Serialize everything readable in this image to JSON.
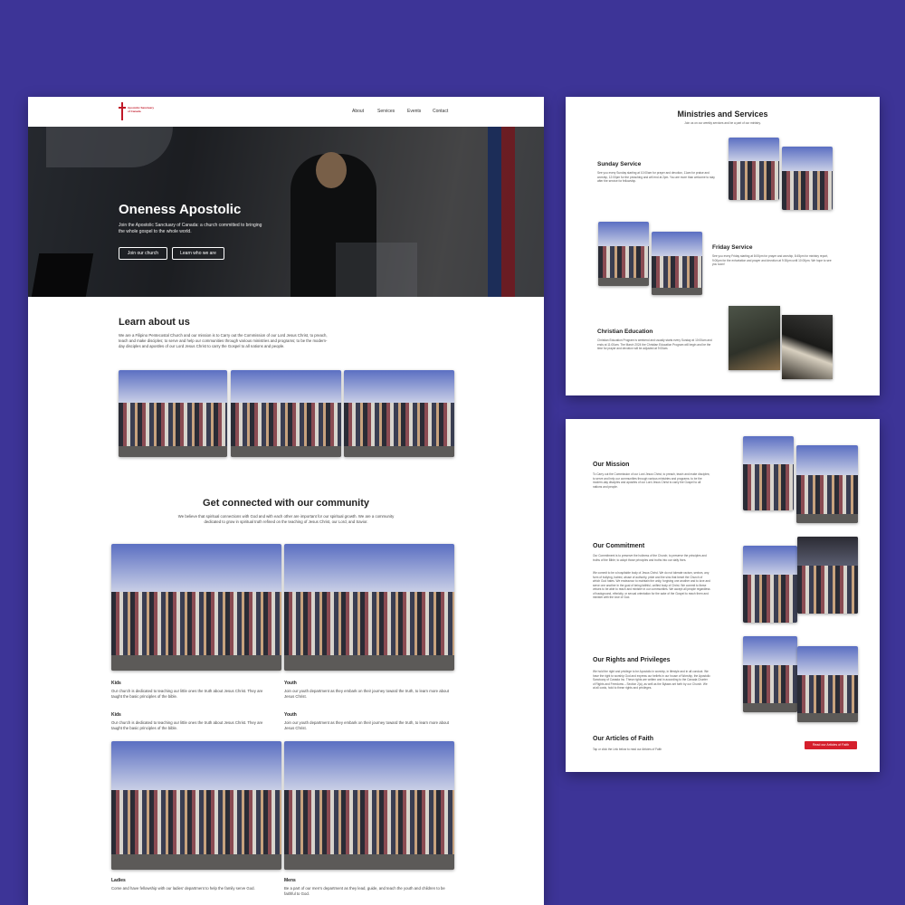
{
  "colors": {
    "background": "#3d3497",
    "accent": "#d51f2c"
  },
  "header": {
    "logo_text": "Apostolic Sanctuary of Canada",
    "nav": [
      "About",
      "Services",
      "Events",
      "Contact"
    ]
  },
  "hero": {
    "title": "Oneness Apostolic",
    "subtitle": "Join the Apostolic Sanctuary of Canada: a church committed to bringing the whole gospel to the whole world.",
    "btn_join": "Join our church",
    "btn_learn": "Learn who we are"
  },
  "learn": {
    "title": "Learn about us",
    "text": "We are a Filipino Pentecostal Church and our mission is to Carry out the Commission of our Lord Jesus Christ, to preach, teach and make disciples; to serve and help our communities through various ministries and programs; to be the modern-day disciples and apostles of our Lord Jesus Christ to carry the Gospel to all nations and people."
  },
  "community": {
    "title": "Get connected with our community",
    "text": "We believe that spiritual connections with God and with each other are important for our spiritual growth. We are a community dedicated to grow in spiritual truth refined on the teaching of Jesus Christ, our Lord, and Savior.",
    "groups": [
      {
        "name": "Kids",
        "desc": "Our church is dedicated to teaching our little ones the truth about Jesus Christ. They are taught the basic principles of the bible."
      },
      {
        "name": "Youth",
        "desc": "Join our youth department as they embark on their journey toward the truth, to learn more about Jesus Christ."
      },
      {
        "name": "Kids",
        "desc": "Our church is dedicated to teaching our little ones the truth about Jesus Christ. They are taught the basic principles of the bible."
      },
      {
        "name": "Youth",
        "desc": "Join our youth department as they embark on their journey toward the truth, to learn more about Jesus Christ."
      },
      {
        "name": "Ladies",
        "desc": "Come and have fellowship with our ladies' department to help the family serve God."
      },
      {
        "name": "Mens",
        "desc": "Be a part of our men's department as they lead, guide, and teach the youth and children to be faithful to God."
      }
    ]
  },
  "ministries": {
    "title": "Ministries and Services",
    "subtitle": "Join us on our weekly services and be a part of our ministry.",
    "items": [
      {
        "name": "Sunday Service",
        "desc": "See you every Sunday starting at 10:00am for prayer and devotion, 11am for praise and worship, 12:00pm for the preaching and will end at 2pm. You are more than welcome to stay after the service for fellowship."
      },
      {
        "name": "Friday Service",
        "desc": "See you every Friday starting at 8:00pm for prayer and worship, 8:45pm for ministry report, 9:00pm for the exhortation and prayer and devotion at 9:30pm until 10:00pm. We hope to see you soon!"
      },
      {
        "name": "Christian Education",
        "desc": "Christian Education Program is weekend and usually starts every Sunday at 10:00am and ends at 11:00am. The March 2024 the Christian Education Program will begin and be the time for prayer and devotion will be adjusted at 9:00am."
      }
    ]
  },
  "about": {
    "mission": {
      "title": "Our Mission",
      "text": "To Carry out the Commission of our Lord Jesus Christ, to preach, teach and make disciples; to serve and help our communities through various ministries and programs; to be the modern-day disciples and apostles of our Lord Jesus Christ to carry the Gospel to all nations and people."
    },
    "commitment": {
      "title": "Our Commitment",
      "text": "Our Commitment is to preserve the holiness of the Church; to preserve the principles and truths of the Bible; to adopt those principles and truths into our daily lives.",
      "text2": "We commit to be a hospitable body of Jesus Christ. We do not tolerate racism, sexism, any form of bullying, hatred, abuse of authority, pride and the sins that beset the Church of which God hates. We endeavour to maintain the unity, forgiving one another and to love and serve one another in the goal of being faithful, unified body of Christ. We commit to these virtues to be able to reach and minister in our communities. We accept all people regardless of background, ethnicity, or sexual orientation for the sake of the Gospel to reach them and minister with the love of God."
    },
    "rights": {
      "title": "Our Rights and Privileges",
      "text": "We hold the right and privilege to be Apostolic in worship, in lifestyle and in all conduct. We have the right to worship God and express our beliefs in our house of Worship, the Apostolic Sanctuary of Canada Inc. These rights are written and in according to the Canada Charter of Rights and Freedoms – Section 2(a), as well as the Bylaws set forth by our Church. We at all costs, hold to these rights and privileges."
    },
    "faith": {
      "title": "Our Articles of Faith",
      "text": "Tap or click the Link below to read our Articles of Faith",
      "button": "Read our Articles of Faith"
    }
  }
}
